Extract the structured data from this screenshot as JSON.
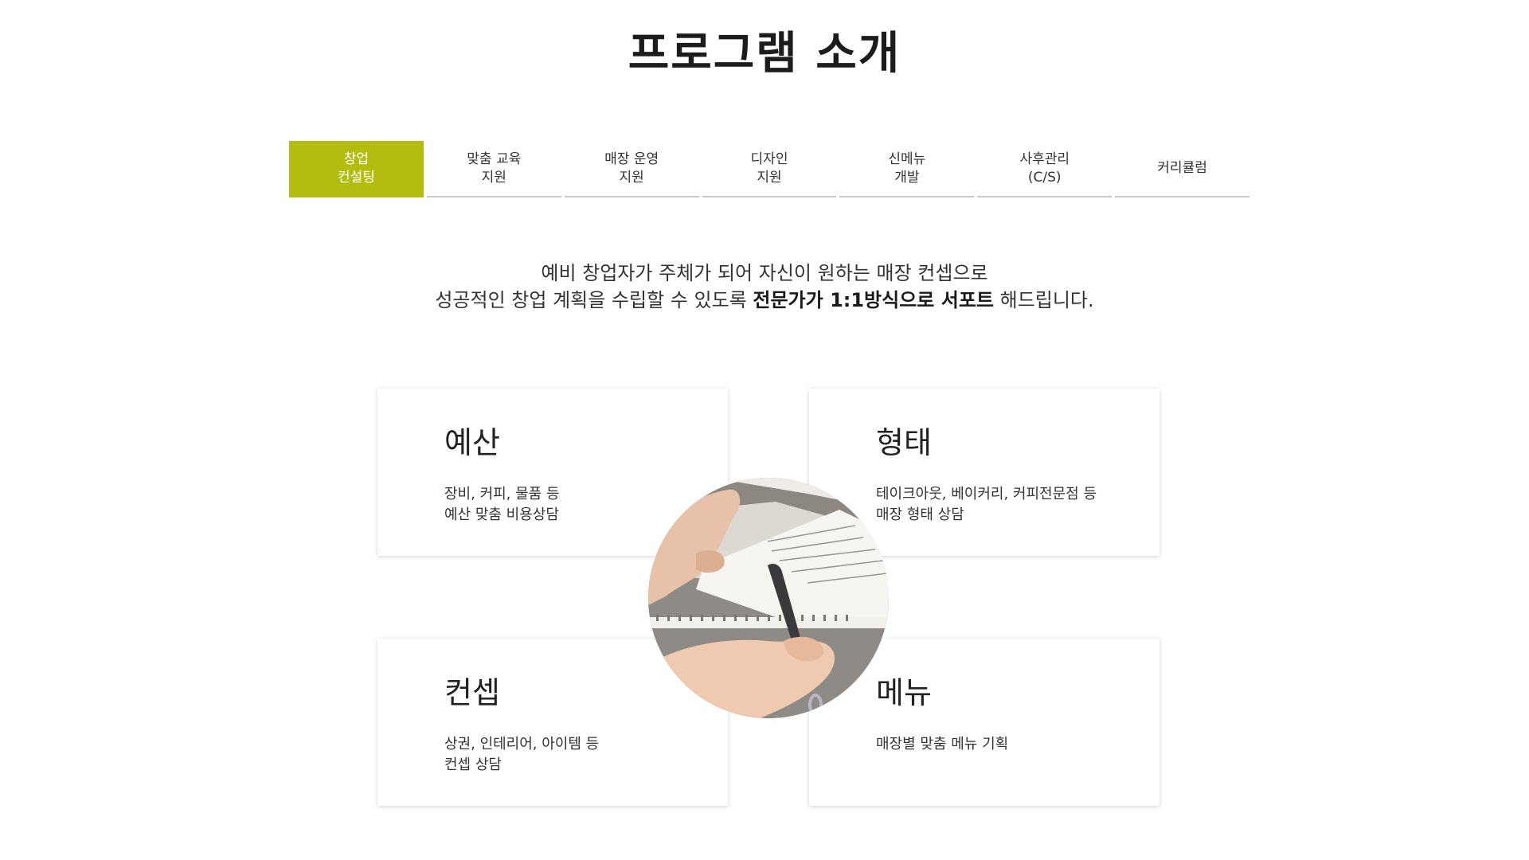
{
  "page": {
    "title": "프로그램 소개"
  },
  "tabs": [
    {
      "label": "창업\n컨설팅",
      "active": true
    },
    {
      "label": "맞춤 교육\n지원",
      "active": false
    },
    {
      "label": "매장 운영\n지원",
      "active": false
    },
    {
      "label": "디자인\n지원",
      "active": false
    },
    {
      "label": "신메뉴\n개발",
      "active": false
    },
    {
      "label": "사후관리\n(C/S)",
      "active": false
    },
    {
      "label": "커리큘럼",
      "active": false
    }
  ],
  "intro": {
    "line1": "예비 창업자가 주체가 되어 자신이 원하는 매장 컨셉으로",
    "line2_prefix": "성공적인 창업 계획을 수립할 수 있도록 ",
    "line2_bold": "전문가가 1:1방식으로 서포트",
    "line2_suffix": " 해드립니다."
  },
  "cards": {
    "budget": {
      "title": "예산",
      "desc": "장비, 커피, 물품 등\n예산 맞춤 비용상담"
    },
    "type": {
      "title": "형태",
      "desc": "테이크아웃, 베이커리, 커피전문점 등\n매장 형태 상담"
    },
    "concept": {
      "title": "컨셉",
      "desc": "상권, 인테리어, 아이템 등\n컨셉 상담"
    },
    "menu": {
      "title": "메뉴",
      "desc": "매장별 맞춤 메뉴 기획"
    }
  },
  "colors": {
    "accent": "#b3bd10",
    "tab_border": "#c9c9c9",
    "text": "#222222"
  },
  "image": {
    "icon": "hands-signing-document-photo"
  }
}
